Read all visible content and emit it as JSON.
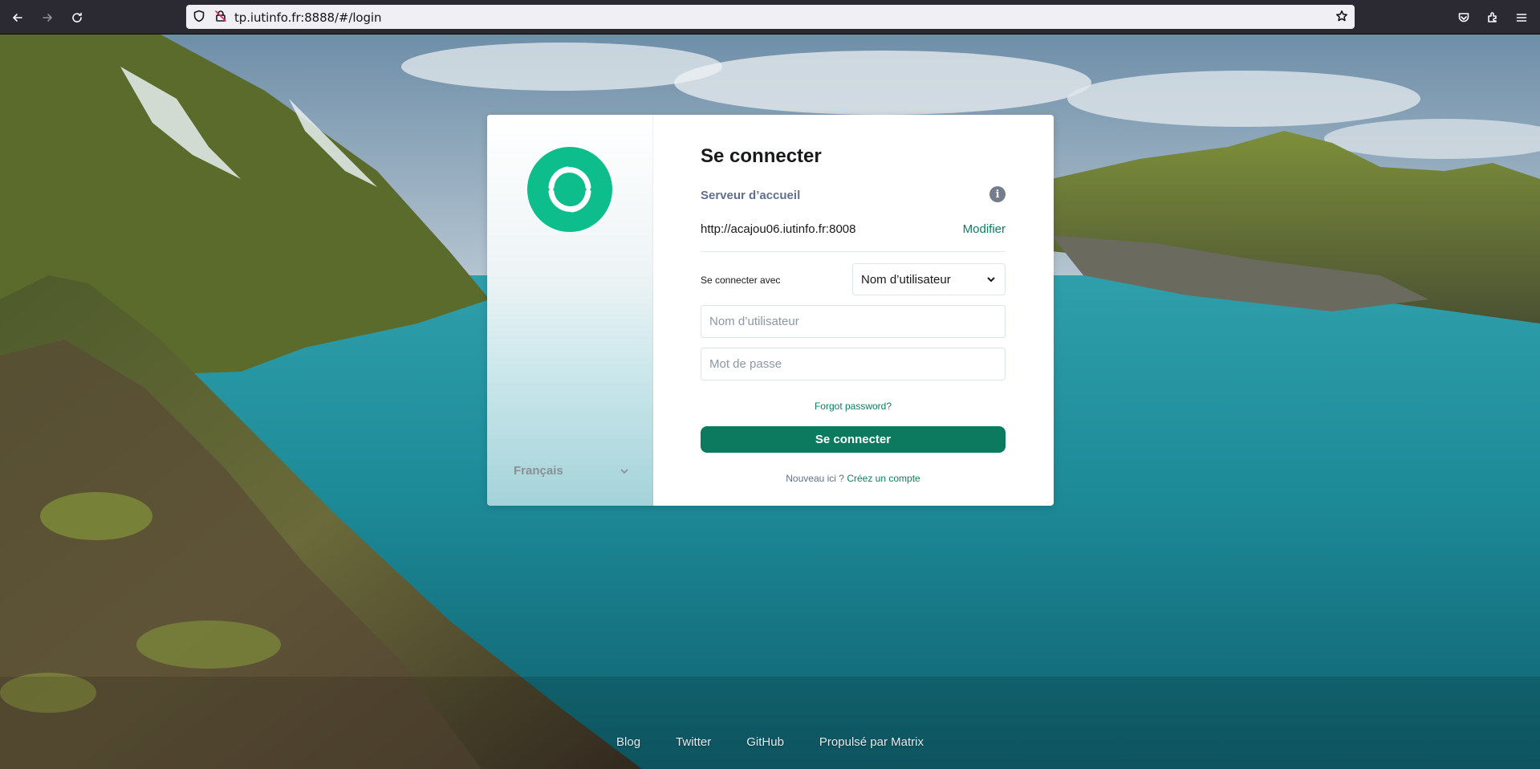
{
  "browser": {
    "url": "tp.iutinfo.fr:8888/#/login",
    "icons": [
      "back-arrow-icon",
      "forward-arrow-icon",
      "reload-icon",
      "shield-icon",
      "insecure-lock-icon",
      "bookmark-star-icon",
      "pocket-icon",
      "extensions-icon",
      "menu-icon"
    ]
  },
  "sidebar": {
    "language": "Français"
  },
  "login": {
    "title": "Se connecter",
    "homeserver_label": "Serveur d’accueil",
    "homeserver_url": "http://acajou06.iutinfo.fr:8008",
    "modify_link": "Modifier",
    "login_with_label": "Se connecter avec",
    "login_with_value": "Nom d’utilisateur",
    "username_placeholder": "Nom d’utilisateur",
    "password_placeholder": "Mot de passe",
    "forgot_password": "Forgot password?",
    "submit_label": "Se connecter",
    "new_here": "Nouveau ici ?",
    "create_account": "Créez un compte"
  },
  "footer": {
    "links": [
      "Blog",
      "Twitter",
      "GitHub",
      "Propulsé par Matrix"
    ]
  },
  "colors": {
    "accent": "#0dbd8b",
    "button": "#0b7a5e",
    "link": "#0a7f5c"
  }
}
